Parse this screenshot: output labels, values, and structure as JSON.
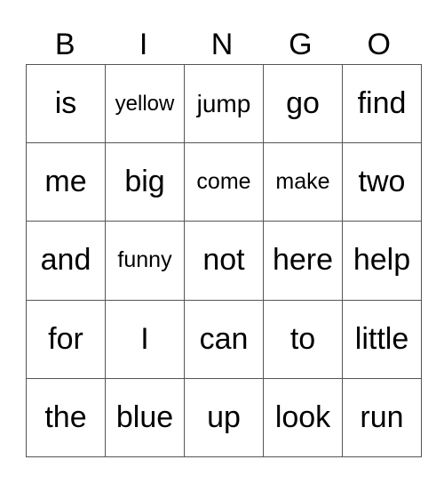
{
  "header": [
    "B",
    "I",
    "N",
    "G",
    "O"
  ],
  "rows": [
    [
      "is",
      "yellow",
      "jump",
      "go",
      "find"
    ],
    [
      "me",
      "big",
      "come",
      "make",
      "two"
    ],
    [
      "and",
      "funny",
      "not",
      "here",
      "help"
    ],
    [
      "for",
      "I",
      "can",
      "to",
      "little"
    ],
    [
      "the",
      "blue",
      "up",
      "look",
      "run"
    ]
  ]
}
